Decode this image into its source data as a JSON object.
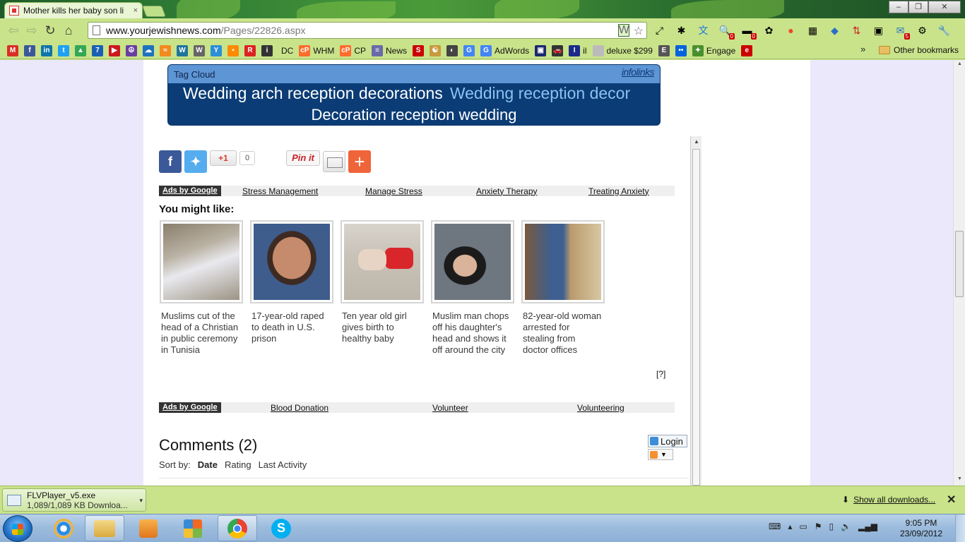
{
  "browser": {
    "tab_title": "Mother kills her baby son li",
    "tab_close": "×",
    "url_host": "www.yourjewishnews.com",
    "url_path": "/Pages/22826.aspx",
    "window_buttons": [
      "‒",
      "❐",
      "✕"
    ],
    "extension_badges": {
      "search": "0",
      "usage": "0",
      "mail": "5"
    }
  },
  "bookmarks": {
    "items": [
      {
        "label": "",
        "icon": "gmail-icon",
        "color": "#d93025",
        "glyph": "M"
      },
      {
        "label": "",
        "icon": "facebook-icon",
        "color": "#3b5998",
        "glyph": "f"
      },
      {
        "label": "",
        "icon": "linkedin-icon",
        "color": "#0e76a8",
        "glyph": "in"
      },
      {
        "label": "",
        "icon": "twitter-icon",
        "color": "#1da1f2",
        "glyph": "t"
      },
      {
        "label": "",
        "icon": "drive-icon",
        "color": "#34a853",
        "glyph": "▲"
      },
      {
        "label": "",
        "icon": "seven-icon",
        "color": "#1a5fb4",
        "glyph": "7"
      },
      {
        "label": "",
        "icon": "youtube-icon",
        "color": "#cc181e",
        "glyph": "▶"
      },
      {
        "label": "",
        "icon": "peace-icon",
        "color": "#6a3fa0",
        "glyph": "☮"
      },
      {
        "label": "",
        "icon": "cloud-icon",
        "color": "#1e73be",
        "glyph": "☁"
      },
      {
        "label": "",
        "icon": "feed-icon",
        "color": "#f28a1e",
        "glyph": "≈"
      },
      {
        "label": "",
        "icon": "wordpress-icon",
        "color": "#21759b",
        "glyph": "W"
      },
      {
        "label": "",
        "icon": "wikipedia-icon",
        "color": "#666666",
        "glyph": "W"
      },
      {
        "label": "",
        "icon": "yahoo-icon",
        "color": "#2b8fd6",
        "glyph": "Y"
      },
      {
        "label": "",
        "icon": "chat-icon",
        "color": "#ff8a00",
        "glyph": "▪"
      },
      {
        "label": "",
        "icon": "r-icon",
        "color": "#d22",
        "glyph": "R"
      },
      {
        "label": "",
        "icon": "info-icon",
        "color": "#333333",
        "glyph": "i"
      },
      {
        "label": "DC",
        "icon": "dc-icon",
        "color": "",
        "glyph": ""
      },
      {
        "label": "WHM",
        "icon": "cpanel-icon",
        "color": "#ff6c2c",
        "glyph": "cP"
      },
      {
        "label": "CP",
        "icon": "cpanel-icon",
        "color": "#ff6c2c",
        "glyph": "cP"
      },
      {
        "label": "News",
        "icon": "news-icon",
        "color": "#6a6aa8",
        "glyph": "≡"
      },
      {
        "label": "",
        "icon": "s-icon",
        "color": "#cc0000",
        "glyph": "S"
      },
      {
        "label": "",
        "icon": "yinyang-icon",
        "color": "#c79a3d",
        "glyph": "☯"
      },
      {
        "label": "",
        "icon": "compass-icon",
        "color": "#444444",
        "glyph": "◐"
      },
      {
        "label": "",
        "icon": "google-icon",
        "color": "#4285f4",
        "glyph": "G"
      },
      {
        "label": "AdWords",
        "icon": "google-icon",
        "color": "#4285f4",
        "glyph": "G"
      },
      {
        "label": "",
        "icon": "box-icon",
        "color": "#1a2a6c",
        "glyph": "▣"
      },
      {
        "label": "",
        "icon": "car-icon",
        "color": "#333333",
        "glyph": "🚗"
      },
      {
        "label": "il",
        "icon": "il-icon",
        "color": "#1c2a8a",
        "glyph": "I"
      },
      {
        "label": "deluxe $299",
        "icon": "page-icon",
        "color": "#bbbbbb",
        "glyph": ""
      },
      {
        "label": "",
        "icon": "doc-icon",
        "color": "#555555",
        "glyph": "E"
      },
      {
        "label": "",
        "icon": "flickr-icon",
        "color": "#0063dc",
        "glyph": "••"
      },
      {
        "label": "Engage",
        "icon": "engage-icon",
        "color": "#4a8f2e",
        "glyph": "✦"
      },
      {
        "label": "",
        "icon": "ebay-icon",
        "color": "#cc0000",
        "glyph": "e"
      }
    ],
    "overflow": "»",
    "other": "Other bookmarks"
  },
  "tag_cloud": {
    "header": "Tag Cloud",
    "brand": "infolinks",
    "tag1": "Wedding arch reception decorations",
    "tag2": "Wedding reception decor",
    "tag3": "Decoration reception wedding"
  },
  "share": {
    "gplus": "+1",
    "gplus_count": "0",
    "pinterest": "Pin it",
    "add": "+"
  },
  "ads1": {
    "label": "Ads by Google",
    "links": [
      "Stress Management",
      "Manage Stress",
      "Anxiety Therapy",
      "Treating Anxiety"
    ]
  },
  "related": {
    "heading": "You might like:",
    "items": [
      {
        "caption": "Muslims cut of the head of a Christian in public ceremony in Tunisia"
      },
      {
        "caption": "17-year-old raped to death in U.S. prison"
      },
      {
        "caption": "Ten year old girl gives birth to healthy baby"
      },
      {
        "caption": "Muslim man chops off his daughter's head and shows it off around the city"
      },
      {
        "caption": "82-year-old woman arrested for stealing from doctor offices"
      }
    ],
    "help": "[?]"
  },
  "ads2": {
    "label": "Ads by Google",
    "links": [
      "Blood Donation",
      "Volunteer",
      "Volunteering"
    ]
  },
  "comments": {
    "title": "Comments (2)",
    "sort_label": "Sort by:",
    "sort_options": [
      "Date",
      "Rating",
      "Last Activity"
    ],
    "login": "Login"
  },
  "downloads": {
    "file": "FLVPlayer_v5.exe",
    "progress": "1,089/1,089 KB Downloa...",
    "show_all": "Show all downloads...",
    "close": "✕"
  },
  "taskbar": {
    "time": "9:05 PM",
    "date": "23/09/2012"
  },
  "colors": {
    "chrome_theme": "#c9e38a",
    "tagcloud_bg": "#0b3c75",
    "tagcloud_header": "#5e95d4",
    "page_bg": "#ebe8fb"
  }
}
